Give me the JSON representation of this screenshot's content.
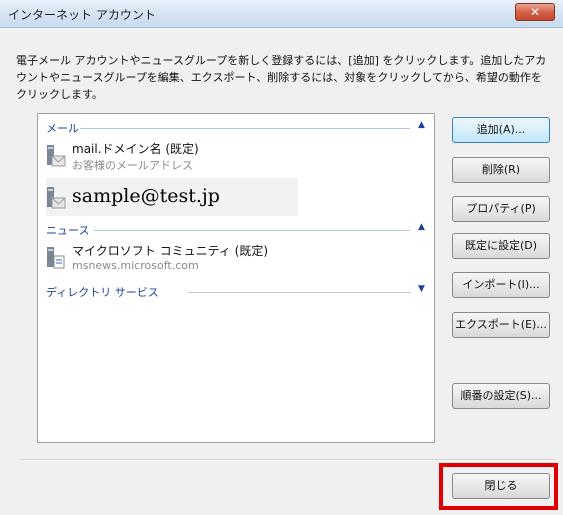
{
  "window": {
    "title": "インターネット アカウント",
    "close_glyph": "✕"
  },
  "description": "電子メール アカウントやニュースグループを新しく登録するには、[追加] をクリックします。追加したアカウントやニュースグループを編集、エクスポート、削除するには、対象をクリックしてから、希望の動作をクリックします。",
  "groups": {
    "mail": {
      "label": "メール",
      "arrow": "▲"
    },
    "news": {
      "label": "ニュース",
      "arrow": "▲"
    },
    "directory": {
      "label": "ディレクトリ サービス",
      "arrow": "▼"
    }
  },
  "accounts": {
    "mail_default": {
      "name": "mail.ドメイン名 (既定)",
      "sub": "お客様のメールアドレス"
    },
    "sample": {
      "name": "sample@test.jp"
    },
    "news_default": {
      "name": "マイクロソフト コミュニティ (既定)",
      "sub": "msnews.microsoft.com"
    }
  },
  "buttons": {
    "add": "追加(A)...",
    "remove": "削除(R)",
    "properties": "プロパティ(P)",
    "set_default": "既定に設定(D)",
    "import": "インポート(I)...",
    "export": "エクスポート(E)...",
    "order": "順番の設定(S)...",
    "close": "閉じる"
  },
  "colors": {
    "highlight": "#e00000",
    "group_text": "#1e3fa0"
  }
}
